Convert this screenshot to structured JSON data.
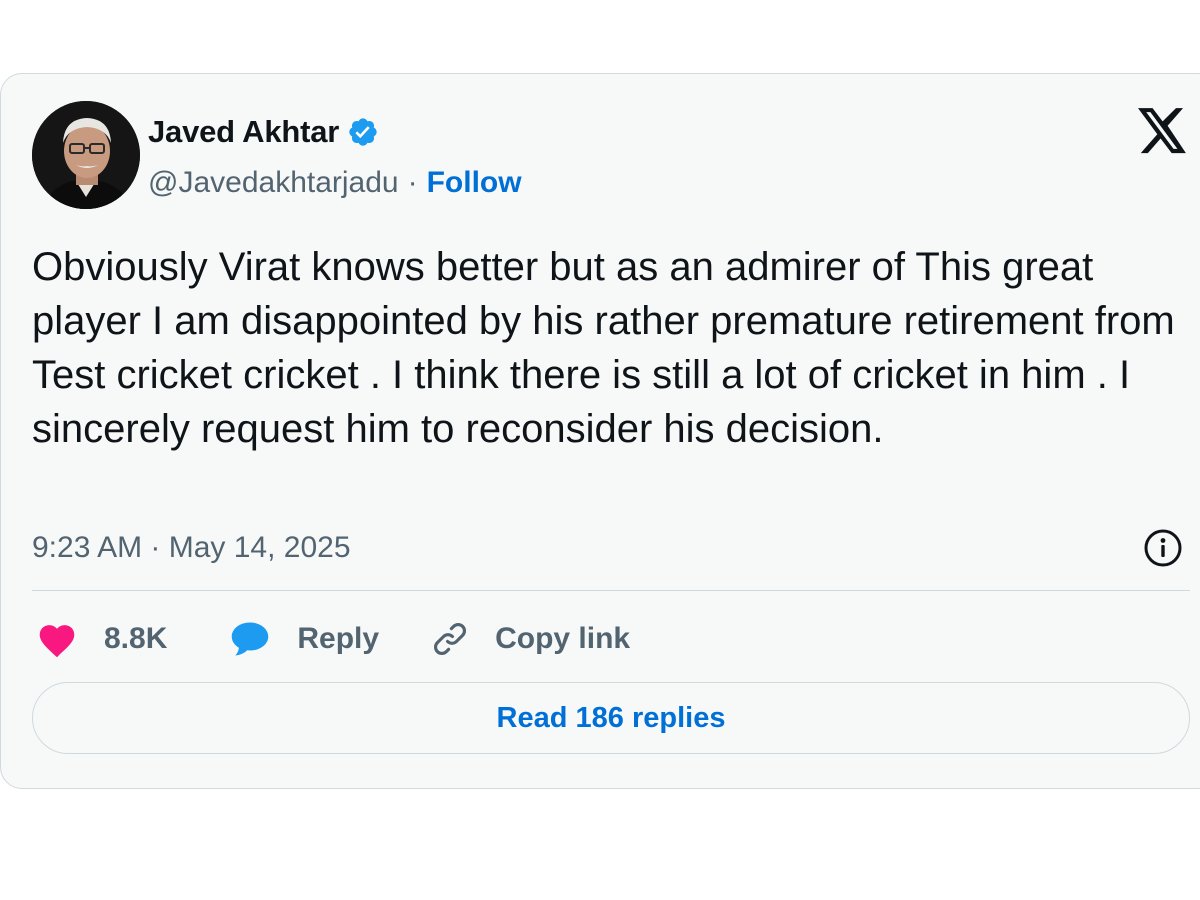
{
  "author": {
    "name": "Javed Akhtar",
    "handle": "@Javedakhtarjadu",
    "separator": "·",
    "follow_label": "Follow"
  },
  "tweet": {
    "text": "Obviously Virat knows better but as an admirer of This great player I am disappointed by his rather premature retirement from Test cricket cricket . I think there is still a lot of cricket in him . I sincerely request him to reconsider his decision.",
    "timestamp": "9:23 AM · May 14, 2025"
  },
  "actions": {
    "like_count": "8.8K",
    "reply_label": "Reply",
    "copy_link_label": "Copy link"
  },
  "read_replies_label": "Read 186 replies",
  "icons": {
    "platform_logo": "x-logo-icon",
    "verified": "verified-badge-icon",
    "info": "info-icon",
    "like": "heart-icon",
    "reply": "speech-bubble-icon",
    "copy_link": "link-icon"
  },
  "colors": {
    "link_blue": "#006fd6",
    "verified_blue": "#1d9bf0",
    "like_pink": "#f91880",
    "muted_text": "#536471",
    "primary_text": "#0f1419",
    "card_bg": "#f7f9f9",
    "border": "#cfd9de"
  }
}
